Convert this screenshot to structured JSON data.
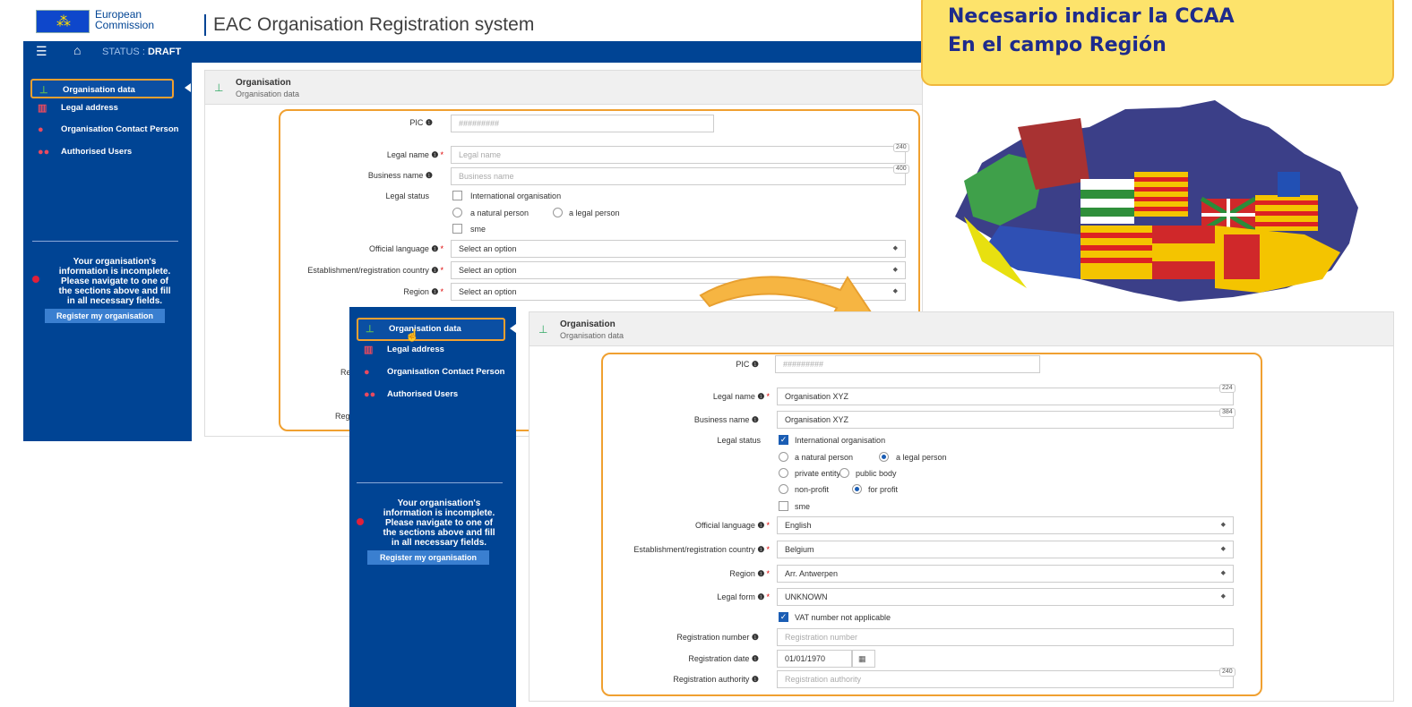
{
  "header": {
    "eu_line1": "European",
    "eu_line2": "Commission",
    "app_title": "EAC Organisation Registration system",
    "status_label": "STATUS :",
    "status_value": "DRAFT"
  },
  "callout": {
    "line1": "Necesario indicar la CCAA",
    "line2": "En el campo Región"
  },
  "sidebar": {
    "items": [
      {
        "label": "Organisation data",
        "icon": "sitemap-icon"
      },
      {
        "label": "Legal address",
        "icon": "bank-icon"
      },
      {
        "label": "Organisation Contact Person",
        "icon": "user-icon"
      },
      {
        "label": "Authorised Users",
        "icon": "users-icon"
      }
    ],
    "message": [
      "Your organisation's",
      "information is incomplete.",
      "Please navigate to one of",
      "the sections above and fill",
      "in all necessary fields."
    ],
    "register_button": "Register my organisation"
  },
  "panel": {
    "title": "Organisation",
    "subtitle": "Organisation data"
  },
  "form_before": {
    "pic_label": "PIC",
    "pic_placeholder": "#########",
    "legal_name_label": "Legal name",
    "legal_name_placeholder": "Legal name",
    "legal_name_count": "240",
    "business_name_label": "Business name",
    "business_name_placeholder": "Business name",
    "business_name_count": "400",
    "legal_status_label": "Legal status",
    "intl_org": "International organisation",
    "natural_person": "a natural person",
    "legal_person": "a legal person",
    "sme": "sme",
    "official_language_label": "Official language",
    "establishment_label": "Establishment/registration country",
    "region_label": "Region",
    "select_placeholder": "Select an option",
    "partial_label_1": "Re",
    "partial_label_2": "Reg"
  },
  "form_after": {
    "pic_label": "PIC",
    "pic_placeholder": "#########",
    "legal_name_label": "Legal name",
    "legal_name_value": "Organisation XYZ",
    "legal_name_count": "224",
    "business_name_label": "Business name",
    "business_name_value": "Organisation XYZ",
    "business_name_count": "384",
    "legal_status_label": "Legal status",
    "intl_org": "International organisation",
    "natural_person": "a natural person",
    "legal_person": "a legal person",
    "private_entity": "private entity",
    "public_body": "public body",
    "non_profit": "non-profit",
    "for_profit": "for profit",
    "sme": "sme",
    "official_language_label": "Official language",
    "official_language_value": "English",
    "establishment_label": "Establishment/registration country",
    "establishment_value": "Belgium",
    "region_label": "Region",
    "region_value": "Arr. Antwerpen",
    "legal_form_label": "Legal form",
    "legal_form_value": "UNKNOWN",
    "vat_label": "VAT number not applicable",
    "reg_number_label": "Registration number",
    "reg_number_placeholder": "Registration number",
    "reg_date_label": "Registration date",
    "reg_date_value": "01/01/1970",
    "reg_authority_label": "Registration authority",
    "reg_authority_placeholder": "Registration authority",
    "reg_authority_count": "240"
  },
  "colors": {
    "nav_blue": "#004494",
    "highlight_orange": "#f0a030",
    "callout_yellow": "#fde36b",
    "callout_text": "#1e2b8c"
  }
}
